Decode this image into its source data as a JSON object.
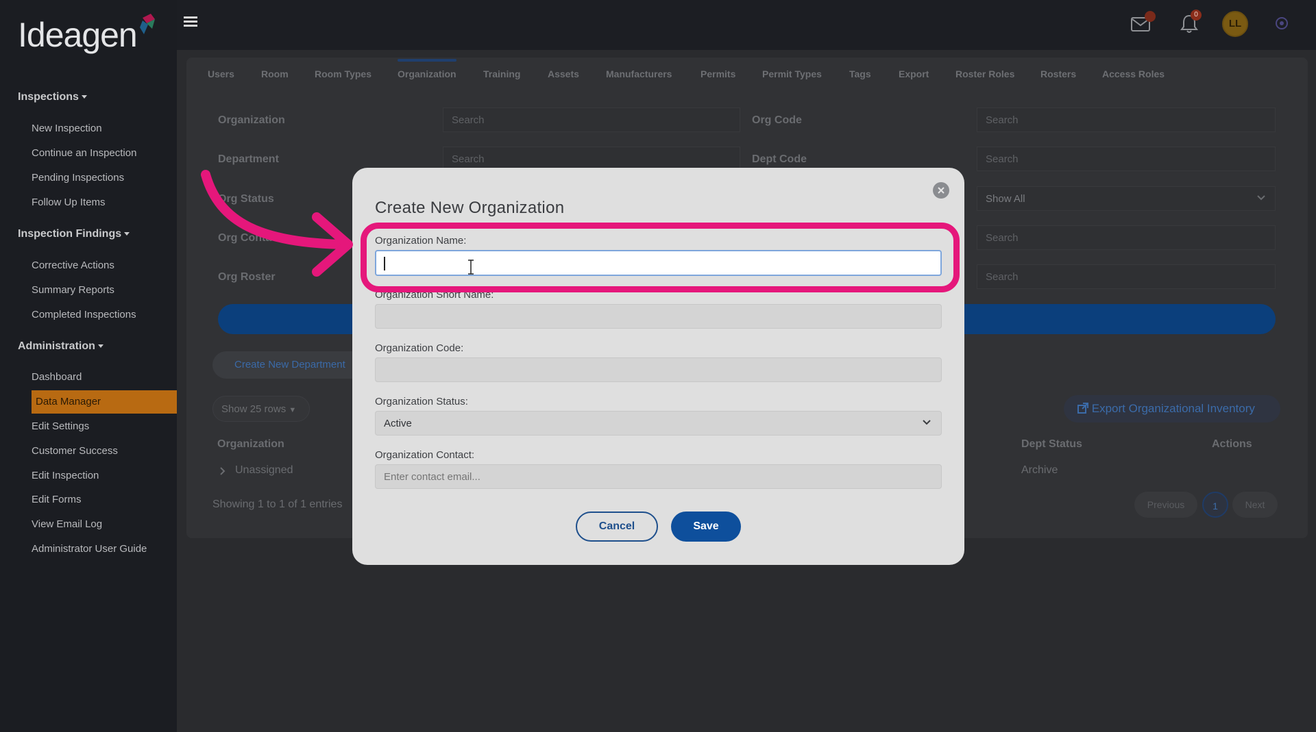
{
  "app": {
    "logo_text": "Ideagen"
  },
  "topbar": {
    "mail_badge": "",
    "notification_badge": "0",
    "avatar_initials": "LL"
  },
  "sidebar": {
    "sections": [
      {
        "title": "Inspections",
        "items": [
          "New Inspection",
          "Continue an Inspection",
          "Pending Inspections",
          "Follow Up Items"
        ]
      },
      {
        "title": "Inspection Findings",
        "items": [
          "Corrective Actions",
          "Summary Reports",
          "Completed Inspections"
        ]
      },
      {
        "title": "Administration",
        "items": [
          "Dashboard",
          "Data Manager",
          "Edit Settings",
          "Customer Success",
          "Edit Inspection",
          "Edit Forms",
          "View Email Log",
          "Administrator User Guide"
        ]
      }
    ],
    "active_item": "Data Manager"
  },
  "tabs": [
    "Users",
    "Room",
    "Room Types",
    "Organization",
    "Training",
    "Assets",
    "Manufacturers",
    "Permits",
    "Permit Types",
    "Tags",
    "Export",
    "Roster Roles",
    "Rosters",
    "Access Roles"
  ],
  "active_tab": "Organization",
  "filters": {
    "organization_label": "Organization",
    "department_label": "Department",
    "org_status_label": "Org Status",
    "org_contact_label": "Org Contact",
    "org_roster_label": "Org Roster",
    "org_code_label": "Org Code",
    "dept_code_label": "Dept Code",
    "search_placeholder": "Search",
    "status_value": "Show All"
  },
  "list": {
    "create_department_label": "Create New Department",
    "rows_select": "Show 25 rows",
    "export_label": "Export Organizational Inventory",
    "columns": {
      "organization": "Organization",
      "dept_status": "Dept Status",
      "actions": "Actions"
    },
    "row": {
      "organization": "Unassigned",
      "dept_status": "Archive"
    },
    "entries_text": "Showing 1 to 1 of 1 entries",
    "pagination": {
      "previous": "Previous",
      "current": "1",
      "next": "Next"
    }
  },
  "modal": {
    "title": "Create New Organization",
    "name_label": "Organization Name:",
    "name_value": "",
    "short_name_label": "Organization Short Name:",
    "code_label": "Organization Code:",
    "status_label": "Organization Status:",
    "status_value": "Active",
    "contact_label": "Organization Contact:",
    "contact_placeholder": "Enter contact email...",
    "cancel_label": "Cancel",
    "save_label": "Save"
  },
  "colors": {
    "highlight": "#e5177b",
    "accent_blue": "#0e4f9c",
    "active_nav": "#b86a12"
  }
}
